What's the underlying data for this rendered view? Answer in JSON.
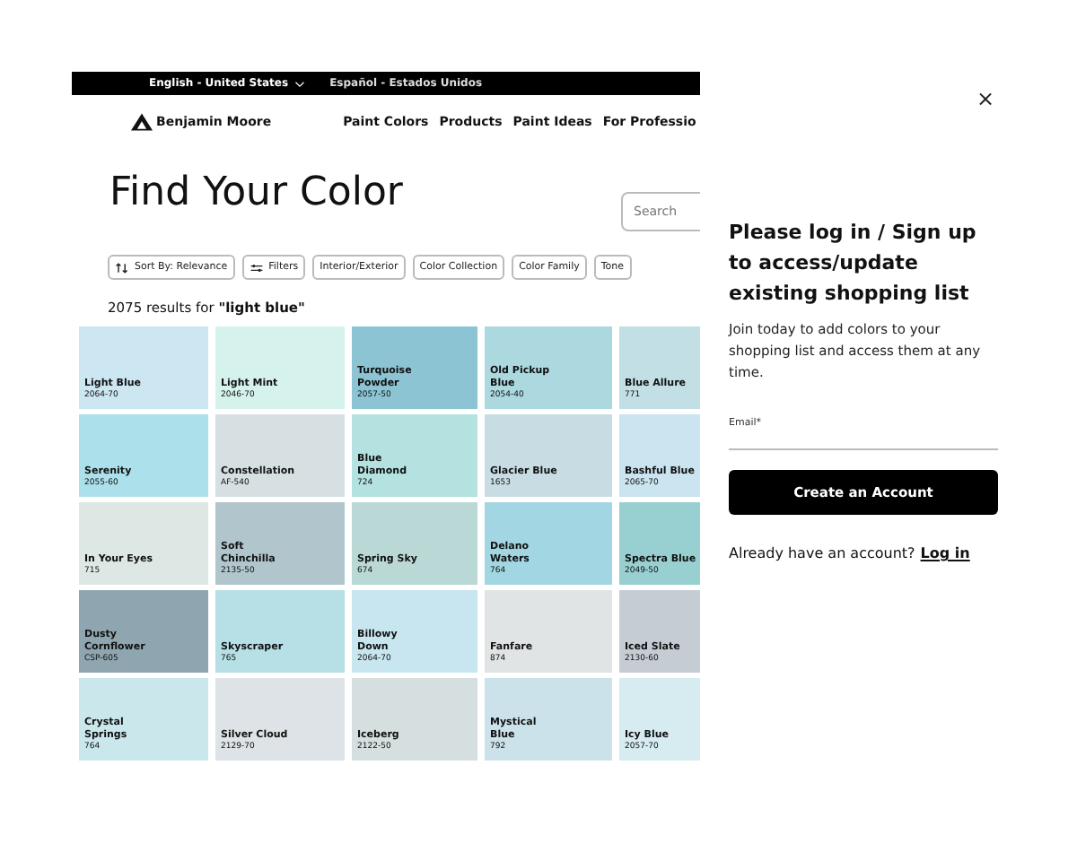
{
  "top_bar": {
    "languages": [
      {
        "label": "English - United States",
        "selected": true
      },
      {
        "label": "Español - Estados Unidos",
        "selected": false
      }
    ]
  },
  "logo": "Benjamin Moore",
  "nav": [
    "Paint Colors",
    "Products",
    "Paint Ideas",
    "For Professio"
  ],
  "title": "Find Your Color",
  "search": {
    "placeholder": "Search"
  },
  "filters": [
    {
      "label": "Sort By: Relevance",
      "kind": "sort"
    },
    {
      "label": "Filters",
      "kind": "filters"
    },
    {
      "label": "Interior/Exterior",
      "kind": "plain"
    },
    {
      "label": "Color Collection",
      "kind": "plain"
    },
    {
      "label": "Color Family",
      "kind": "plain"
    },
    {
      "label": "Tone",
      "kind": "plain"
    }
  ],
  "results": "2075 results for **\"light blue\"**",
  "swatches": [
    {
      "name": "Light Blue",
      "code": "2064-70",
      "color": "#cce6f2"
    },
    {
      "name": "Light Mint",
      "code": "2046-70",
      "color": "#d5f2ec"
    },
    {
      "name": "Turquoise Powder",
      "code": "2057-50",
      "color": "#8cc4d4"
    },
    {
      "name": "Old Pickup Blue",
      "code": "2054-40",
      "color": "#acd8e0"
    },
    {
      "name": "Blue Allure",
      "code": "771",
      "color": "#c2dfe5"
    },
    {
      "name": "Serenity",
      "code": "2055-60",
      "color": "#ace0ea"
    },
    {
      "name": "Constellation",
      "code": "AF-540",
      "color": "#d6e0e2"
    },
    {
      "name": "Blue Diamond",
      "code": "724",
      "color": "#b3e2e0"
    },
    {
      "name": "Glacier Blue",
      "code": "1653",
      "color": "#c8dde3"
    },
    {
      "name": "Bashful Blue",
      "code": "2065-70",
      "color": "#cae4f0"
    },
    {
      "name": "In Your Eyes",
      "code": "715",
      "color": "#dde7e4"
    },
    {
      "name": "Soft Chinchilla",
      "code": "2135-50",
      "color": "#b0c6cc"
    },
    {
      "name": "Spring Sky",
      "code": "674",
      "color": "#bad9d6"
    },
    {
      "name": "Delano Waters",
      "code": "764",
      "color": "#a2d6e2"
    },
    {
      "name": "Spectra Blue",
      "code": "2049-50",
      "color": "#98d0d2"
    },
    {
      "name": "Dusty Cornflower",
      "code": "CSP-605",
      "color": "#8fa6b0"
    },
    {
      "name": "Skyscraper",
      "code": "765",
      "color": "#b6dfe6"
    },
    {
      "name": "Billowy Down",
      "code": "2064-70",
      "color": "#c8e6f0"
    },
    {
      "name": "Fanfare",
      "code": "874",
      "color": "#e1e4e4"
    },
    {
      "name": "Iced Slate",
      "code": "2130-60",
      "color": "#c5ccd4"
    },
    {
      "name": "Crystal Springs",
      "code": "764",
      "color": "#cae8ec"
    },
    {
      "name": "Silver Cloud",
      "code": "2129-70",
      "color": "#dde3e6"
    },
    {
      "name": "Iceberg",
      "code": "2122-50",
      "color": "#d6dfdf"
    },
    {
      "name": "Mystical Blue",
      "code": "792",
      "color": "#cce2ea"
    },
    {
      "name": "Icy Blue",
      "code": "2057-70",
      "color": "#d6ecf0"
    }
  ],
  "panel": {
    "close": "×",
    "heading": "Please log in / Sign up to access/update existing shopping list",
    "text": "Join today to add colors to your shopping list and access them at any time.",
    "email_label": "Email*",
    "button": "Create an Account",
    "login_prompt": "Already have an account?",
    "login_link": "Log in"
  }
}
